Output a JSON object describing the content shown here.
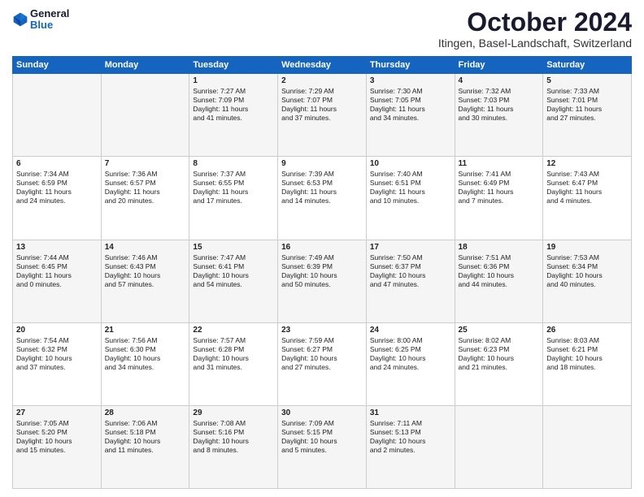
{
  "header": {
    "logo_line1": "General",
    "logo_line2": "Blue",
    "title": "October 2024",
    "subtitle": "Itingen, Basel-Landschaft, Switzerland"
  },
  "columns": [
    "Sunday",
    "Monday",
    "Tuesday",
    "Wednesday",
    "Thursday",
    "Friday",
    "Saturday"
  ],
  "weeks": [
    [
      {
        "day": "",
        "lines": []
      },
      {
        "day": "",
        "lines": []
      },
      {
        "day": "1",
        "lines": [
          "Sunrise: 7:27 AM",
          "Sunset: 7:09 PM",
          "Daylight: 11 hours",
          "and 41 minutes."
        ]
      },
      {
        "day": "2",
        "lines": [
          "Sunrise: 7:29 AM",
          "Sunset: 7:07 PM",
          "Daylight: 11 hours",
          "and 37 minutes."
        ]
      },
      {
        "day": "3",
        "lines": [
          "Sunrise: 7:30 AM",
          "Sunset: 7:05 PM",
          "Daylight: 11 hours",
          "and 34 minutes."
        ]
      },
      {
        "day": "4",
        "lines": [
          "Sunrise: 7:32 AM",
          "Sunset: 7:03 PM",
          "Daylight: 11 hours",
          "and 30 minutes."
        ]
      },
      {
        "day": "5",
        "lines": [
          "Sunrise: 7:33 AM",
          "Sunset: 7:01 PM",
          "Daylight: 11 hours",
          "and 27 minutes."
        ]
      }
    ],
    [
      {
        "day": "6",
        "lines": [
          "Sunrise: 7:34 AM",
          "Sunset: 6:59 PM",
          "Daylight: 11 hours",
          "and 24 minutes."
        ]
      },
      {
        "day": "7",
        "lines": [
          "Sunrise: 7:36 AM",
          "Sunset: 6:57 PM",
          "Daylight: 11 hours",
          "and 20 minutes."
        ]
      },
      {
        "day": "8",
        "lines": [
          "Sunrise: 7:37 AM",
          "Sunset: 6:55 PM",
          "Daylight: 11 hours",
          "and 17 minutes."
        ]
      },
      {
        "day": "9",
        "lines": [
          "Sunrise: 7:39 AM",
          "Sunset: 6:53 PM",
          "Daylight: 11 hours",
          "and 14 minutes."
        ]
      },
      {
        "day": "10",
        "lines": [
          "Sunrise: 7:40 AM",
          "Sunset: 6:51 PM",
          "Daylight: 11 hours",
          "and 10 minutes."
        ]
      },
      {
        "day": "11",
        "lines": [
          "Sunrise: 7:41 AM",
          "Sunset: 6:49 PM",
          "Daylight: 11 hours",
          "and 7 minutes."
        ]
      },
      {
        "day": "12",
        "lines": [
          "Sunrise: 7:43 AM",
          "Sunset: 6:47 PM",
          "Daylight: 11 hours",
          "and 4 minutes."
        ]
      }
    ],
    [
      {
        "day": "13",
        "lines": [
          "Sunrise: 7:44 AM",
          "Sunset: 6:45 PM",
          "Daylight: 11 hours",
          "and 0 minutes."
        ]
      },
      {
        "day": "14",
        "lines": [
          "Sunrise: 7:46 AM",
          "Sunset: 6:43 PM",
          "Daylight: 10 hours",
          "and 57 minutes."
        ]
      },
      {
        "day": "15",
        "lines": [
          "Sunrise: 7:47 AM",
          "Sunset: 6:41 PM",
          "Daylight: 10 hours",
          "and 54 minutes."
        ]
      },
      {
        "day": "16",
        "lines": [
          "Sunrise: 7:49 AM",
          "Sunset: 6:39 PM",
          "Daylight: 10 hours",
          "and 50 minutes."
        ]
      },
      {
        "day": "17",
        "lines": [
          "Sunrise: 7:50 AM",
          "Sunset: 6:37 PM",
          "Daylight: 10 hours",
          "and 47 minutes."
        ]
      },
      {
        "day": "18",
        "lines": [
          "Sunrise: 7:51 AM",
          "Sunset: 6:36 PM",
          "Daylight: 10 hours",
          "and 44 minutes."
        ]
      },
      {
        "day": "19",
        "lines": [
          "Sunrise: 7:53 AM",
          "Sunset: 6:34 PM",
          "Daylight: 10 hours",
          "and 40 minutes."
        ]
      }
    ],
    [
      {
        "day": "20",
        "lines": [
          "Sunrise: 7:54 AM",
          "Sunset: 6:32 PM",
          "Daylight: 10 hours",
          "and 37 minutes."
        ]
      },
      {
        "day": "21",
        "lines": [
          "Sunrise: 7:56 AM",
          "Sunset: 6:30 PM",
          "Daylight: 10 hours",
          "and 34 minutes."
        ]
      },
      {
        "day": "22",
        "lines": [
          "Sunrise: 7:57 AM",
          "Sunset: 6:28 PM",
          "Daylight: 10 hours",
          "and 31 minutes."
        ]
      },
      {
        "day": "23",
        "lines": [
          "Sunrise: 7:59 AM",
          "Sunset: 6:27 PM",
          "Daylight: 10 hours",
          "and 27 minutes."
        ]
      },
      {
        "day": "24",
        "lines": [
          "Sunrise: 8:00 AM",
          "Sunset: 6:25 PM",
          "Daylight: 10 hours",
          "and 24 minutes."
        ]
      },
      {
        "day": "25",
        "lines": [
          "Sunrise: 8:02 AM",
          "Sunset: 6:23 PM",
          "Daylight: 10 hours",
          "and 21 minutes."
        ]
      },
      {
        "day": "26",
        "lines": [
          "Sunrise: 8:03 AM",
          "Sunset: 6:21 PM",
          "Daylight: 10 hours",
          "and 18 minutes."
        ]
      }
    ],
    [
      {
        "day": "27",
        "lines": [
          "Sunrise: 7:05 AM",
          "Sunset: 5:20 PM",
          "Daylight: 10 hours",
          "and 15 minutes."
        ]
      },
      {
        "day": "28",
        "lines": [
          "Sunrise: 7:06 AM",
          "Sunset: 5:18 PM",
          "Daylight: 10 hours",
          "and 11 minutes."
        ]
      },
      {
        "day": "29",
        "lines": [
          "Sunrise: 7:08 AM",
          "Sunset: 5:16 PM",
          "Daylight: 10 hours",
          "and 8 minutes."
        ]
      },
      {
        "day": "30",
        "lines": [
          "Sunrise: 7:09 AM",
          "Sunset: 5:15 PM",
          "Daylight: 10 hours",
          "and 5 minutes."
        ]
      },
      {
        "day": "31",
        "lines": [
          "Sunrise: 7:11 AM",
          "Sunset: 5:13 PM",
          "Daylight: 10 hours",
          "and 2 minutes."
        ]
      },
      {
        "day": "",
        "lines": []
      },
      {
        "day": "",
        "lines": []
      }
    ]
  ]
}
